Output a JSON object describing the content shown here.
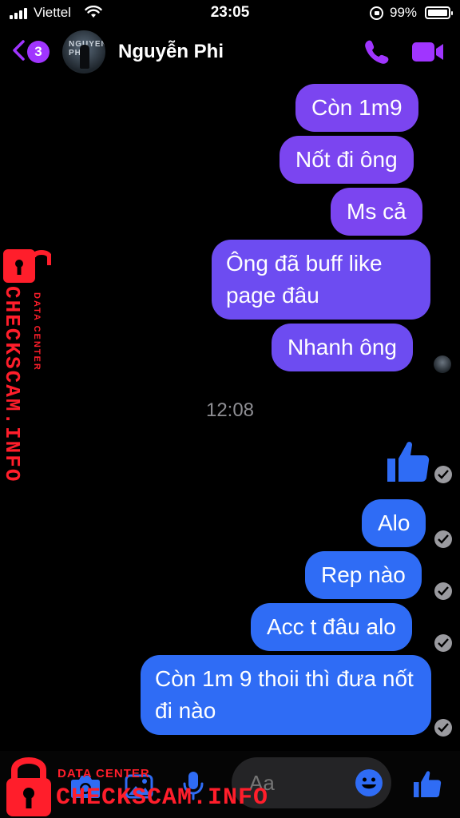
{
  "status_bar": {
    "carrier": "Viettel",
    "time": "23:05",
    "battery": "99%"
  },
  "header": {
    "unread_count": "3",
    "avatar_text": "NGUYEN PHI",
    "contact_name": "Nguyễn Phi"
  },
  "messages": {
    "received": [
      {
        "text": "Còn 1m9"
      },
      {
        "text": "Nốt đi ông"
      },
      {
        "text": "Ms cả"
      },
      {
        "text": "Ông đã buff like page đâu"
      },
      {
        "text": "Nhanh ông"
      }
    ],
    "time_separator": "12:08",
    "sent": [
      {
        "text": "Alo"
      },
      {
        "text": "Rep nào"
      },
      {
        "text": "Acc t đâu alo"
      },
      {
        "text": "Còn 1m 9 thoii thì đưa nốt đi nào"
      }
    ]
  },
  "composer": {
    "placeholder": "Aa"
  },
  "watermark": {
    "small": "DATA CENTER",
    "big": "CHECKSCAM.INFO"
  },
  "colors": {
    "accent": "#a035ff",
    "bubble_purple": "#7b45f0",
    "bubble_blue": "#2f6cf5",
    "watermark_red": "#ff1e2b"
  },
  "icons": [
    "signal-icon",
    "wifi-icon",
    "rotation-lock-icon",
    "battery-icon",
    "back-chevron-icon",
    "phone-icon",
    "video-camera-icon",
    "thumbs-up-icon",
    "check-circle-icon",
    "camera-icon",
    "image-icon",
    "microphone-icon",
    "emoji-icon",
    "lock-icon"
  ]
}
